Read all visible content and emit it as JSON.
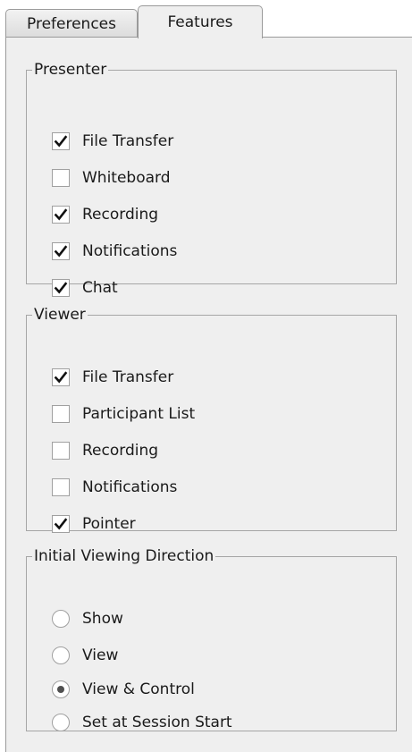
{
  "tabs": [
    {
      "label": "Preferences",
      "active": false
    },
    {
      "label": "Features",
      "active": true
    }
  ],
  "presenter": {
    "title": "Presenter",
    "items": [
      {
        "label": "File Transfer",
        "checked": true
      },
      {
        "label": "Whiteboard",
        "checked": false
      },
      {
        "label": "Recording",
        "checked": true
      },
      {
        "label": "Notifications",
        "checked": true
      },
      {
        "label": "Chat",
        "checked": true
      }
    ]
  },
  "viewer": {
    "title": "Viewer",
    "items": [
      {
        "label": "File Transfer",
        "checked": true
      },
      {
        "label": "Participant List",
        "checked": false
      },
      {
        "label": "Recording",
        "checked": false
      },
      {
        "label": "Notifications",
        "checked": false
      },
      {
        "label": "Pointer",
        "checked": true
      }
    ]
  },
  "viewing_direction": {
    "title": "Initial Viewing Direction",
    "options": [
      {
        "label": "Show",
        "selected": false
      },
      {
        "label": "View",
        "selected": false
      },
      {
        "label": "View & Control",
        "selected": true
      },
      {
        "label": "Set at Session Start",
        "selected": false
      }
    ]
  }
}
